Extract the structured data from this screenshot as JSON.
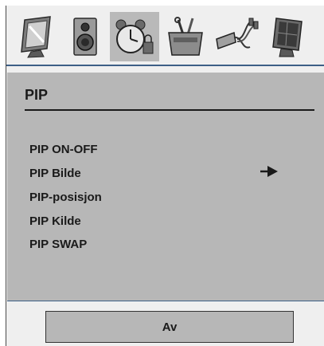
{
  "toolbar": {
    "tabs": [
      {
        "icon": "display-picture-icon",
        "active": false
      },
      {
        "icon": "speaker-icon",
        "active": false
      },
      {
        "icon": "alarm-clock-icon",
        "active": true
      },
      {
        "icon": "toolbox-icon",
        "active": false
      },
      {
        "icon": "cable-connectors-icon",
        "active": false
      },
      {
        "icon": "monitor-stand-icon",
        "active": false
      }
    ],
    "accent_color": "#3d5f86"
  },
  "panel": {
    "title": "PIP",
    "items": [
      {
        "label": "PIP ON-OFF"
      },
      {
        "label": "PIP Bilde",
        "has_submenu_arrow": true
      },
      {
        "label": "PIP-posisjon"
      },
      {
        "label": "PIP Kilde"
      },
      {
        "label": "PIP SWAP"
      }
    ]
  },
  "value_box": {
    "value": "Av"
  }
}
